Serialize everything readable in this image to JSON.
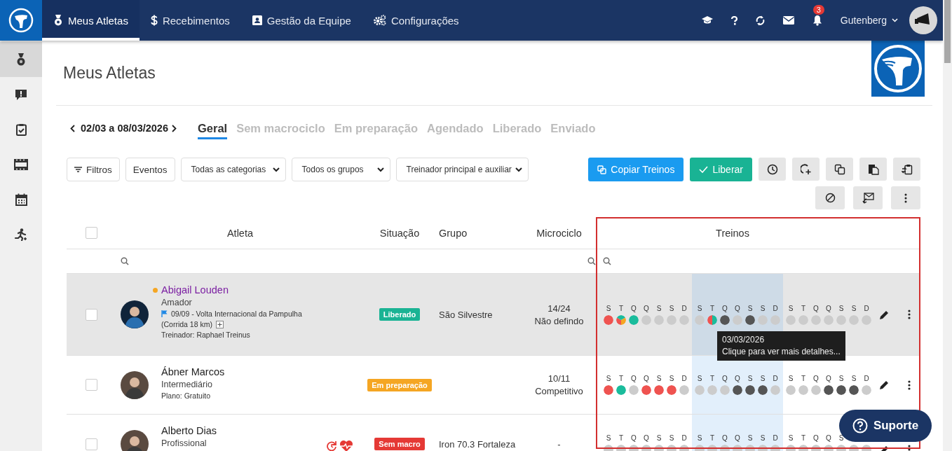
{
  "topbar": {
    "nav": [
      {
        "label": "Meus Atletas",
        "selected": true
      },
      {
        "label": "Recebimentos",
        "selected": false
      },
      {
        "label": "Gestão da Equipe",
        "selected": false
      },
      {
        "label": "Configurações",
        "selected": false
      }
    ],
    "notifications": "3",
    "user": "Gutenberg"
  },
  "sidebar": {
    "items": [
      {
        "selected": true
      },
      {
        "selected": false
      },
      {
        "selected": false
      },
      {
        "selected": false
      },
      {
        "selected": false
      },
      {
        "selected": false
      }
    ]
  },
  "page": {
    "title": "Meus Atletas"
  },
  "week": {
    "range": "02/03 a 08/03/2026"
  },
  "tabs": [
    {
      "label": "Geral",
      "selected": true
    },
    {
      "label": "Sem macrociclo",
      "selected": false
    },
    {
      "label": "Em preparação",
      "selected": false
    },
    {
      "label": "Agendado",
      "selected": false
    },
    {
      "label": "Liberado",
      "selected": false
    },
    {
      "label": "Enviado",
      "selected": false
    }
  ],
  "filters": {
    "buttons": [
      "Filtros",
      "Eventos"
    ],
    "selects": [
      "Todas as categorias",
      "Todos os grupos",
      "Treinador principal e auxiliar"
    ]
  },
  "actions": {
    "copy": "Copiar Treinos",
    "release": "Liberar"
  },
  "table": {
    "all_checked": false,
    "columns": [
      "Atleta",
      "Situação",
      "Grupo",
      "Microciclo",
      "Treinos"
    ],
    "rows": [
      {
        "selected": true,
        "checked": false,
        "name": "Abigail Louden",
        "color": "#f5a623",
        "category": "Amador",
        "event": [
          "09/09 - Volta Internacional da Pampulha",
          "(Corrida 18 km)"
        ],
        "note": "Treinador: Raphael Treinus",
        "status": {
          "label": "Liberado",
          "color": "#1ab394"
        },
        "group": "São Silvestre",
        "micro": [
          "14/24",
          "Não defindo"
        ],
        "tooltip": {
          "title": "03/03/2026",
          "text": "Clique para ver mais detalhes..."
        },
        "weeks": [
          {
            "current": false,
            "days": [
              "S",
              "T",
              "Q",
              "Q",
              "S",
              "S",
              "D"
            ],
            "dots": [
              {
                "segments": [
                  {
                    "color": "#ef5350"
                  }
                ]
              },
              {
                "segments": [
                  {
                    "color": "#ef5350"
                  },
                  {
                    "color": "#1abc9c"
                  },
                  {
                    "color": "#f5a623"
                  }
                ]
              },
              {
                "segments": [
                  {
                    "color": "#1abc9c"
                  }
                ]
              },
              {
                "segments": [
                  {
                    "color": "#cccccc"
                  }
                ]
              },
              {
                "segments": [
                  {
                    "color": "#cccccc"
                  }
                ]
              },
              {
                "segments": [
                  {
                    "color": "#cccccc"
                  }
                ]
              },
              {
                "segments": [
                  {
                    "color": "#cccccc"
                  }
                ]
              }
            ]
          },
          {
            "current": true,
            "days": [
              "S",
              "T",
              "Q",
              "Q",
              "S",
              "S",
              "D"
            ],
            "dots": [
              {
                "segments": [
                  {
                    "color": "#cccccc"
                  }
                ]
              },
              {
                "segments": [
                  {
                    "color": "#ef5350"
                  },
                  {
                    "color": "#1abc9c"
                  }
                ]
              },
              {
                "segments": [
                  {
                    "color": "#555555"
                  }
                ]
              },
              {
                "segments": [
                  {
                    "color": "#cccccc"
                  }
                ]
              },
              {
                "segments": [
                  {
                    "color": "#555555"
                  }
                ]
              },
              {
                "segments": [
                  {
                    "color": "#cccccc"
                  }
                ]
              },
              {
                "segments": [
                  {
                    "color": "#cccccc"
                  }
                ]
              }
            ]
          },
          {
            "current": false,
            "days": [
              "S",
              "T",
              "Q",
              "Q",
              "S",
              "S",
              "D"
            ],
            "dots": [
              {
                "segments": [
                  {
                    "color": "#cccccc"
                  }
                ]
              },
              {
                "segments": [
                  {
                    "color": "#cccccc"
                  }
                ]
              },
              {
                "segments": [
                  {
                    "color": "#cccccc"
                  }
                ]
              },
              {
                "segments": [
                  {
                    "color": "#cccccc"
                  }
                ]
              },
              {
                "segments": [
                  {
                    "color": "#cccccc"
                  }
                ]
              },
              {
                "segments": [
                  {
                    "color": "#cccccc"
                  }
                ]
              },
              {
                "segments": [
                  {
                    "color": "#cccccc"
                  }
                ]
              }
            ]
          }
        ]
      },
      {
        "selected": false,
        "checked": false,
        "name": "Ábner Marcos",
        "category": "Intermediário",
        "note": "Plano: Gratuito",
        "status": {
          "label": "Em preparação",
          "color": "#f5a623"
        },
        "micro": [
          "10/11",
          "Competitivo"
        ],
        "weeks": [
          {
            "current": false,
            "days": [
              "S",
              "T",
              "Q",
              "Q",
              "S",
              "S",
              "D"
            ],
            "dots": [
              {
                "segments": [
                  {
                    "color": "#ef5350"
                  }
                ]
              },
              {
                "segments": [
                  {
                    "color": "#1abc9c"
                  }
                ]
              },
              {
                "segments": [
                  {
                    "color": "#cccccc"
                  }
                ]
              },
              {
                "segments": [
                  {
                    "color": "#ef5350"
                  }
                ]
              },
              {
                "segments": [
                  {
                    "color": "#ef5350"
                  }
                ]
              },
              {
                "segments": [
                  {
                    "color": "#ef5350"
                  }
                ]
              },
              {
                "segments": [
                  {
                    "color": "#cccccc"
                  }
                ]
              }
            ]
          },
          {
            "current": true,
            "days": [
              "S",
              "T",
              "Q",
              "Q",
              "S",
              "S",
              "D"
            ],
            "dots": [
              {
                "segments": [
                  {
                    "color": "#cccccc"
                  }
                ]
              },
              {
                "segments": [
                  {
                    "color": "#cccccc"
                  }
                ]
              },
              {
                "segments": [
                  {
                    "color": "#cccccc"
                  }
                ]
              },
              {
                "segments": [
                  {
                    "color": "#555555"
                  }
                ]
              },
              {
                "segments": [
                  {
                    "color": "#555555"
                  }
                ]
              },
              {
                "segments": [
                  {
                    "color": "#555555"
                  }
                ]
              },
              {
                "segments": [
                  {
                    "color": "#cccccc"
                  }
                ]
              }
            ]
          },
          {
            "current": false,
            "days": [
              "S",
              "T",
              "Q",
              "Q",
              "S",
              "S",
              "D"
            ],
            "dots": [
              {
                "segments": [
                  {
                    "color": "#cccccc"
                  }
                ]
              },
              {
                "segments": [
                  {
                    "color": "#cccccc"
                  }
                ]
              },
              {
                "segments": [
                  {
                    "color": "#cccccc"
                  }
                ]
              },
              {
                "segments": [
                  {
                    "color": "#555555"
                  }
                ]
              },
              {
                "segments": [
                  {
                    "color": "#555555"
                  }
                ]
              },
              {
                "segments": [
                  {
                    "color": "#555555"
                  }
                ]
              },
              {
                "segments": [
                  {
                    "color": "#cccccc"
                  }
                ]
              }
            ]
          }
        ]
      },
      {
        "selected": false,
        "checked": false,
        "name": "Alberto Dias",
        "category": "Profissional",
        "alerts": true,
        "status": {
          "label": "Sem macro",
          "color": "#e53935"
        },
        "group": "Iron 70.3 Fortaleza",
        "micro": [
          "-"
        ],
        "weeks": [
          {
            "current": false,
            "days": [
              "S",
              "T",
              "Q",
              "Q",
              "S",
              "S",
              "D"
            ],
            "dots": [
              {
                "segments": [
                  {
                    "color": "#cccccc"
                  }
                ]
              },
              {
                "segments": [
                  {
                    "color": "#cccccc"
                  }
                ]
              },
              {
                "segments": [
                  {
                    "color": "#cccccc"
                  }
                ]
              },
              {
                "segments": [
                  {
                    "color": "#cccccc"
                  }
                ]
              },
              {
                "segments": [
                  {
                    "color": "#cccccc"
                  }
                ]
              },
              {
                "segments": [
                  {
                    "color": "#cccccc"
                  }
                ]
              },
              {
                "segments": [
                  {
                    "color": "#cccccc"
                  }
                ]
              }
            ]
          },
          {
            "current": true,
            "days": [
              "S",
              "T",
              "Q",
              "Q",
              "S",
              "S",
              "D"
            ],
            "dots": [
              {
                "segments": [
                  {
                    "color": "#cccccc"
                  }
                ]
              },
              {
                "segments": [
                  {
                    "color": "#cccccc"
                  }
                ]
              },
              {
                "segments": [
                  {
                    "color": "#cccccc"
                  }
                ]
              },
              {
                "segments": [
                  {
                    "color": "#cccccc"
                  }
                ]
              },
              {
                "segments": [
                  {
                    "color": "#cccccc"
                  }
                ]
              },
              {
                "segments": [
                  {
                    "color": "#cccccc"
                  }
                ]
              },
              {
                "segments": [
                  {
                    "color": "#cccccc"
                  }
                ]
              }
            ]
          },
          {
            "current": false,
            "days": [
              "S",
              "T",
              "Q",
              "Q",
              "S"
            ],
            "dots": [
              {
                "segments": [
                  {
                    "color": "#cccccc"
                  }
                ]
              },
              {
                "segments": [
                  {
                    "color": "#cccccc"
                  }
                ]
              },
              {
                "segments": [
                  {
                    "color": "#cccccc"
                  }
                ]
              },
              {
                "segments": [
                  {
                    "color": "#cccccc"
                  }
                ]
              },
              {
                "segments": [
                  {
                    "color": "#cccccc"
                  }
                ]
              },
              {
                "segments": [
                  {
                    "color": "#cccccc"
                  }
                ]
              },
              {
                "segments": [
                  {
                    "color": "#cccccc"
                  }
                ]
              }
            ]
          }
        ]
      }
    ]
  },
  "support": "Suporte"
}
